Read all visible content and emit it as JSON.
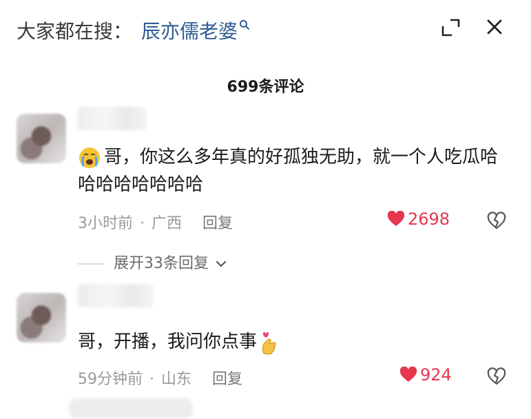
{
  "header": {
    "search_prefix": "大家都在搜：",
    "search_term": "辰亦儒老婆"
  },
  "comments_count": "699条评论",
  "comments": [
    {
      "emoji": "crying-face-emoji",
      "text": "哥，你这么多年真的好孤独无助，就一个人吃瓜哈哈哈哈哈哈哈哈",
      "time": "3小时前",
      "location": "广西",
      "reply_label": "回复",
      "likes": "2698",
      "expand_label": "展开33条回复"
    },
    {
      "text": "哥，开播，我问你点事",
      "trailing_emoji": "finger-heart-emoji",
      "time": "59分钟前",
      "location": "山东",
      "reply_label": "回复",
      "likes": "924"
    }
  ],
  "separator": "·",
  "colors": {
    "link": "#2f5d95",
    "like_red": "#e7364e",
    "meta_gray": "#9a9a9a"
  }
}
